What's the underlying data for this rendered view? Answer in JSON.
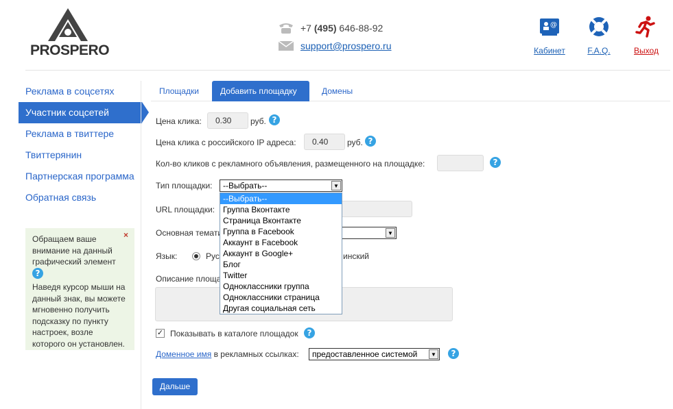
{
  "header": {
    "logo_text": "PROSPERO",
    "phone_prefix": "+7 ",
    "phone_code": "(495)",
    "phone_number": " 646-88-92",
    "email": "support@prospero.ru",
    "links": [
      {
        "label": "Кабинет",
        "icon": "cabinet-icon",
        "color": "#1a5fb4"
      },
      {
        "label": "F.A.Q.",
        "icon": "lifebuoy-icon",
        "color": "#1a5fb4"
      },
      {
        "label": "Выход",
        "icon": "exit-runner-icon",
        "color": "#cc1111"
      }
    ]
  },
  "sidebar": {
    "items": [
      {
        "label": "Реклама в соцсетях"
      },
      {
        "label": "Участник соцсетей"
      },
      {
        "label": "Реклама в твиттере"
      },
      {
        "label": "Твиттерянин"
      },
      {
        "label": "Партнерская программа"
      },
      {
        "label": "Обратная связь"
      }
    ],
    "hint": {
      "line1": "Обращаем ваше внимание на данный графический элемент",
      "line2": "Наведя курсор мыши на данный знак, вы можете мгновенно получить подсказку по пункту настроек, возле которого он установлен.",
      "close": "×"
    }
  },
  "tabs": [
    {
      "label": "Площадки"
    },
    {
      "label": "Добавить площадку"
    },
    {
      "label": "Домены"
    }
  ],
  "form": {
    "click_price_label": "Цена клика:",
    "click_price_value": "0.30",
    "currency": "руб.",
    "ru_price_label": "Цена клика с российского IP адреса:",
    "ru_price_value": "0.40",
    "clicks_label": "Кол-во кликов с рекламного объявления, размещенного на площадке:",
    "clicks_value": "",
    "type_label": "Тип площадки:",
    "type_selected": "--Выбрать--",
    "type_options": [
      "--Выбрать--",
      "Группа Вконтакте",
      "Страница Вконтакте",
      "Группа в Facebook",
      "Аккаунт в Facebook",
      "Аккаунт в Google+",
      "Блог",
      "Twitter",
      "Одноклассники группа",
      "Одноклассники страница",
      "Другая социальная сеть"
    ],
    "url_label": "URL площадки:",
    "topic_label": "Основная темати",
    "lang_label": "Язык:",
    "lang_ru": "Рус",
    "lang_other": "инский",
    "desc_label": "Описание площа",
    "catalog_label": "Показывать в каталоге площадок",
    "domain_link": "Доменное имя",
    "domain_suffix": " в рекламных ссылках:",
    "domain_selected": "предоставленное системой",
    "help_glyph": "?",
    "submit": "Дальше"
  }
}
